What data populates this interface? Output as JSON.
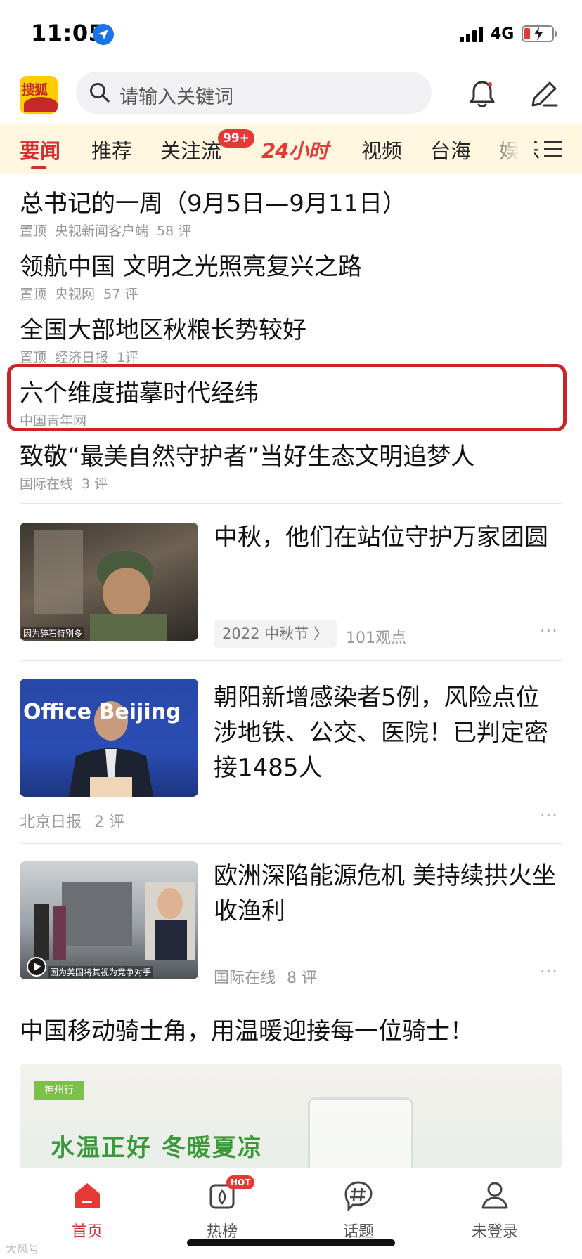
{
  "status_bar": {
    "time": "11:05",
    "network": "4G"
  },
  "search": {
    "placeholder": "请输入关键词"
  },
  "tabs": [
    {
      "label": "要闻",
      "active": true
    },
    {
      "label": "推荐"
    },
    {
      "label": "关注流",
      "badge": "99+"
    },
    {
      "label": "24小时"
    },
    {
      "label": "视频"
    },
    {
      "label": "台海"
    },
    {
      "label": "娱乐"
    }
  ],
  "top_news": [
    {
      "title": "总书记的一周（9月5日—9月11日）",
      "tag": "置顶",
      "source": "央视新闻客户端",
      "comments": "58 评"
    },
    {
      "title": "领航中国 文明之光照亮复兴之路",
      "tag": "置顶",
      "source": "央视网",
      "comments": "57 评"
    },
    {
      "title": "全国大部地区秋粮长势较好",
      "tag": "置顶",
      "source": "经济日报",
      "comments": "1评"
    },
    {
      "title": "六个维度描摹时代经纬",
      "source": "中国青年网"
    },
    {
      "title": "致敬“最美自然守护者”当好生态文明追梦人",
      "source": "国际在线",
      "comments": "3 评"
    }
  ],
  "image_news": [
    {
      "title": "中秋，他们在站位守护万家团圆",
      "topic": "2022 中秋节 〉",
      "stat": "101观点",
      "thumb_caption": "因为碎石特别多"
    },
    {
      "title": "朝阳新增感染者5例，风险点位涉地铁、公交、医院！已判定密接1485人",
      "source": "北京日报",
      "comments": "2 评",
      "thumb_caption": "Office  Beijing"
    },
    {
      "title": "欧洲深陷能源危机 美持续拱火坐收渔利",
      "source": "国际在线",
      "comments": "8 评",
      "thumb_caption": "因为美国将其视为竞争对手"
    }
  ],
  "ad": {
    "title": "中国移动骑士角，用温暖迎接每一位骑士！",
    "slogan": "水温正好 冬暖夏凉",
    "brand": "神州行"
  },
  "bottom_nav": [
    {
      "label": "首页",
      "active": true
    },
    {
      "label": "热榜",
      "badge": "HOT"
    },
    {
      "label": "话题"
    },
    {
      "label": "未登录"
    }
  ],
  "more_label": "···",
  "watermark": "大风号",
  "colors": {
    "brand_red": "#d32f2f",
    "tab_bg": "#fff7e0",
    "highlight": "#c62828"
  }
}
